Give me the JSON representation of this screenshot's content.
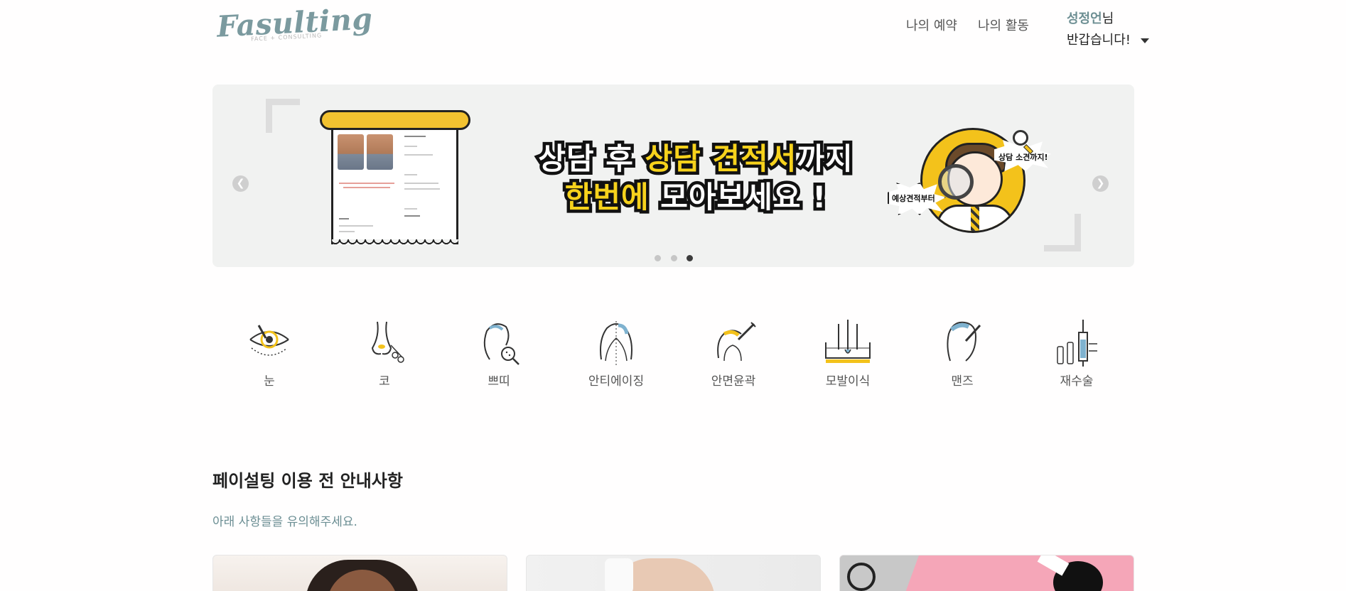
{
  "header": {
    "logo_main": "Fasulting",
    "logo_sub": "FACE + CONSULTING",
    "nav": [
      "나의 예약",
      "나의 활동"
    ],
    "user_name": "성정언",
    "user_suffix": "님",
    "greeting": "반갑습니다!"
  },
  "carousel": {
    "headline_line1_a": "상담 후 ",
    "headline_line1_b": "상담 견적서",
    "headline_line1_c": "까지",
    "headline_line2_a": "한번에",
    "headline_line2_b": " 모아보세요 !",
    "burst_left": "예상견적부터",
    "burst_right": "상담 소견까지!",
    "prev_icon": "chevron-left-icon",
    "next_icon": "chevron-right-icon",
    "slide_count": 3,
    "active_slide": 3
  },
  "categories": [
    {
      "label": "눈",
      "icon": "eye-icon"
    },
    {
      "label": "코",
      "icon": "nose-icon"
    },
    {
      "label": "쁘띠",
      "icon": "petit-icon"
    },
    {
      "label": "안티에이징",
      "icon": "anti-aging-icon"
    },
    {
      "label": "안면윤곽",
      "icon": "facial-contour-icon"
    },
    {
      "label": "모발이식",
      "icon": "hair-transplant-icon"
    },
    {
      "label": "맨즈",
      "icon": "mens-icon"
    },
    {
      "label": "재수술",
      "icon": "revision-icon"
    }
  ],
  "notice": {
    "title": "페이설팅 이용 전 안내사항",
    "subtitle": "아래 사항들을 유의해주세요."
  },
  "colors": {
    "brand": "#7b9a9f",
    "accent_yellow": "#f3c21b",
    "banner_bg": "#f1f2f1"
  }
}
